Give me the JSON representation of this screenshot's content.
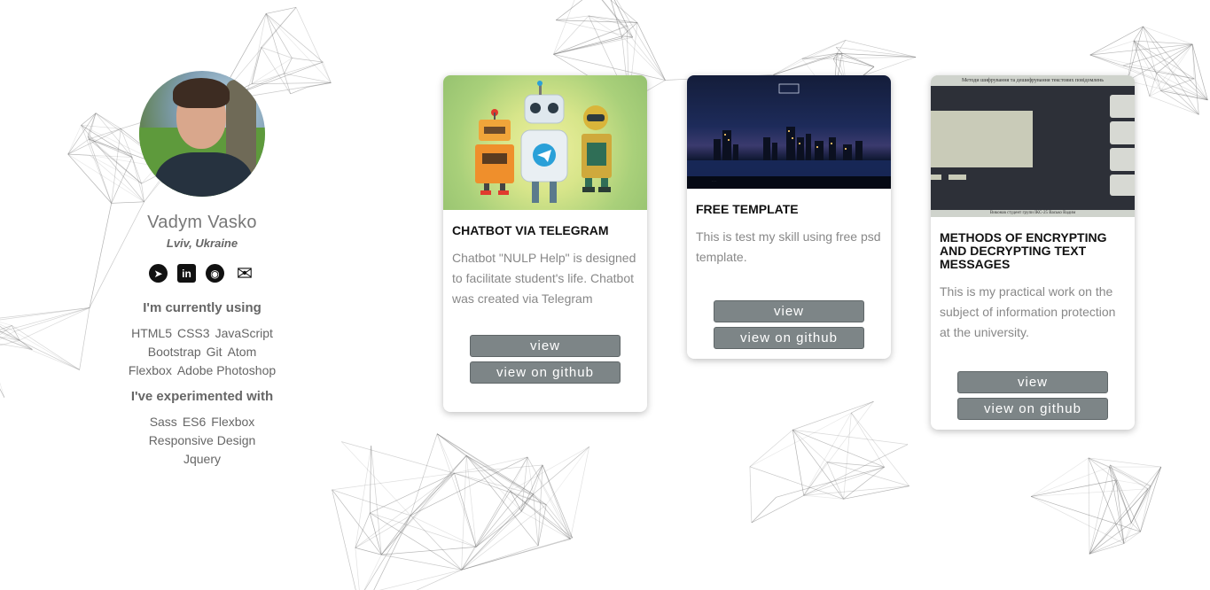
{
  "profile": {
    "name": "Vadym Vasko",
    "location": "Lviv, Ukraine",
    "social": [
      {
        "icon": "telegram-icon",
        "glyph": "➤"
      },
      {
        "icon": "linkedin-icon",
        "glyph": "in"
      },
      {
        "icon": "github-icon",
        "glyph": "◉"
      },
      {
        "icon": "email-icon",
        "glyph": "✉"
      }
    ],
    "using_title": "I'm currently using",
    "using": [
      "HTML5",
      "CSS3",
      "JavaScript",
      "Bootstrap",
      "Git",
      "Atom",
      "Flexbox",
      "Adobe Photoshop"
    ],
    "experimented_title": "I've experimented with",
    "experimented": [
      "Sass",
      "ES6",
      "Flexbox",
      "Responsive Design",
      "Jquery"
    ]
  },
  "cards": [
    {
      "title": "CHATBOT VIA TELEGRAM",
      "description": "Chatbot \"NULP Help\" is designed to facilitate student's life. Chatbot was created via Telegram",
      "view_label": "view",
      "github_label": "view on github"
    },
    {
      "title": "FREE TEMPLATE",
      "description": "This is test my skill using free psd template.",
      "view_label": "view",
      "github_label": "view on github"
    },
    {
      "title": "METHODS OF ENCRYPTING AND DECRYPTING TEXT MESSAGES",
      "description": "This is my practical work on the subject of information protection at the university.",
      "view_label": "view",
      "github_label": "view on github",
      "thumb_header": "Методи шифрування та дешифрування текстових повідомлень",
      "thumb_footer": "Виконав студент групи ІКС-25 Васько Вадим"
    }
  ],
  "colors": {
    "button_bg": "#7d8587",
    "card_title": "#111111",
    "text_muted": "#888888"
  }
}
